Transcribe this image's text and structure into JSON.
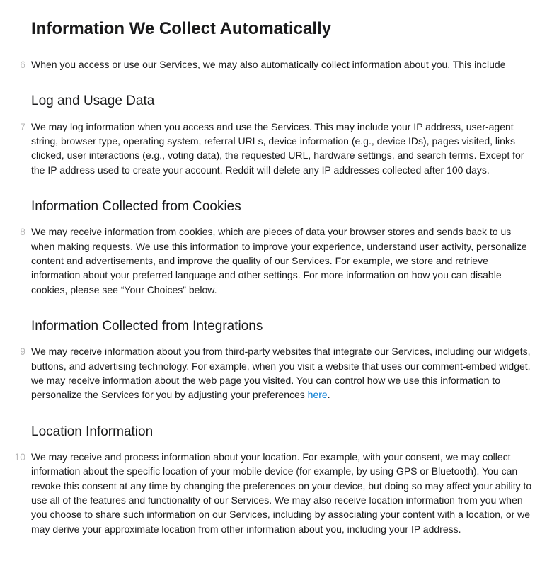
{
  "title": "Information We Collect Automatically",
  "sections": [
    {
      "num": "6",
      "heading": null,
      "body_before": "When you access or use our Services, we may also automatically collect information about you. This include",
      "link": null,
      "body_after": ""
    },
    {
      "num": "7",
      "heading": "Log and Usage Data",
      "body_before": "We may log information when you access and use the Services. This may include your IP address, user-agent string, browser type, operating system, referral URLs, device information (e.g., device IDs), pages visited, links clicked, user interactions (e.g., voting data), the requested URL, hardware settings, and search terms. Except for the IP address used to create your account, Reddit will delete any IP addresses collected after 100 days.",
      "link": null,
      "body_after": ""
    },
    {
      "num": "8",
      "heading": "Information Collected from Cookies",
      "body_before": "We may receive information from cookies, which are pieces of data your browser stores and sends back to us when making requests. We use this information to improve your experience, understand user activity, personalize content and advertisements, and improve the quality of our Services. For example, we store and retrieve information about your preferred language and other settings. For more information on how you can disable cookies, please see “Your Choices” below.",
      "link": null,
      "body_after": ""
    },
    {
      "num": "9",
      "heading": "Information Collected from Integrations",
      "body_before": "We may receive information about you from third-party websites that integrate our Services, including our widgets, buttons, and advertising technology. For example, when you visit a website that uses our comment-embed widget, we may receive information about the web page you visited. You can control how we use this information to personalize the Services for you by adjusting your preferences ",
      "link": "here",
      "body_after": "."
    },
    {
      "num": "10",
      "heading": "Location Information",
      "body_before": "We may receive and process information about your location. For example, with your consent, we may collect information about the specific location of your mobile device (for example, by using GPS or Bluetooth). You can revoke this consent at any time by changing the preferences on your device, but doing so may affect your ability to use all of the features and functionality of our Services. We may also receive location information from you when you choose to share such information on our Services, including by associating your content with a location, or we may derive your approximate location from other information about you, including your IP address.",
      "link": null,
      "body_after": ""
    }
  ]
}
